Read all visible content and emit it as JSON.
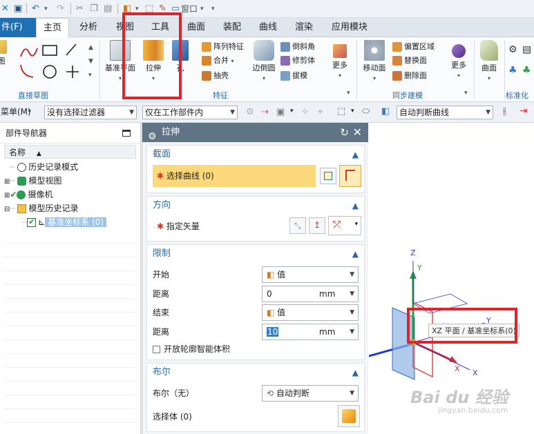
{
  "tabs": {
    "file": "件(F)",
    "items": [
      "主页",
      "分析",
      "视图",
      "工具",
      "曲面",
      "装配",
      "曲线",
      "渲染",
      "应用模块"
    ]
  },
  "quickaccess": {
    "window_label": "窗口"
  },
  "ribbon": {
    "groups": {
      "sketch": "直接草图",
      "feature": "特征",
      "sync": "同步建模",
      "standard": "标准化工"
    },
    "sketch_label": "图",
    "datum_plane": "基准平面",
    "extrude": "拉伸",
    "hole": "孔",
    "pattern_feature": "阵列特征",
    "unite": "合并",
    "shell": "抽壳",
    "edge_blend": "边倒圆",
    "chamfer": "倒斜角",
    "trim_body": "修剪体",
    "draft": "拔模",
    "more1": "更多",
    "move_face": "移动面",
    "offset_region": "偏置区域",
    "replace_face": "替换面",
    "delete_face": "删除面",
    "more2": "更多",
    "surface": "曲面"
  },
  "filterbar": {
    "menu": "菜单(M)",
    "filter": "没有选择过滤器",
    "scope": "仅在工作部件内",
    "curve_rule": "自动判断曲线"
  },
  "navigator": {
    "title": "部件导航器",
    "column": "名称",
    "items": [
      "历史记录模式",
      "模型视图",
      "摄像机",
      "模型历史记录",
      "基准坐标系 (0)"
    ]
  },
  "dialog": {
    "title": "拉伸",
    "section_curve": "截面",
    "select_curve": "选择曲线 (0)",
    "section_direction": "方向",
    "specify_vector": "指定矢量",
    "section_limits": "限制",
    "start_label": "开始",
    "start_value": "值",
    "distance_label": "距离",
    "start_distance": "0",
    "end_label": "结束",
    "end_value": "值",
    "end_distance": "10",
    "unit": "mm",
    "open_profile": "开放轮廓智能体积",
    "section_boolean": "布尔",
    "boolean_label": "布尔（无）",
    "boolean_value": "自动判断",
    "select_body": "选择体 (0)"
  },
  "viewport": {
    "axis_x": "X",
    "axis_y": "Y",
    "axis_z": "Z",
    "tooltip": "XZ 平面 / 基准坐标系(0)"
  },
  "watermark": {
    "brand": "Bai du 经验",
    "url": "jingyan.baidu.com"
  },
  "colors": {
    "accent": "#2a6aa8",
    "file_tab": "#1f6fb5",
    "dialog_title": "#5f7585",
    "highlight_field": "#fbd87a",
    "annotation_red": "#e0232b"
  }
}
